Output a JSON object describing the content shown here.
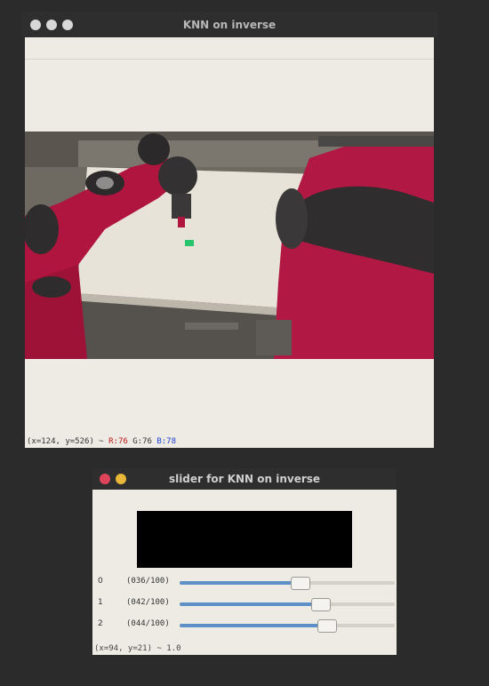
{
  "main_window": {
    "title": "KNN on inverse",
    "status": {
      "coords": "(x=124, y=526) ~ ",
      "r": "R:76",
      "g": "G:76",
      "b": "B:78"
    }
  },
  "slider_window": {
    "title": "slider for KNN on inverse",
    "sliders": [
      {
        "index": "0",
        "value_text": "(036/100)",
        "value": 36
      },
      {
        "index": "1",
        "value_text": "(042/100)",
        "value": 42
      },
      {
        "index": "2",
        "value_text": "(044/100)",
        "value": 44
      }
    ],
    "status": "(x=94, y=21) ~ 1.0"
  }
}
